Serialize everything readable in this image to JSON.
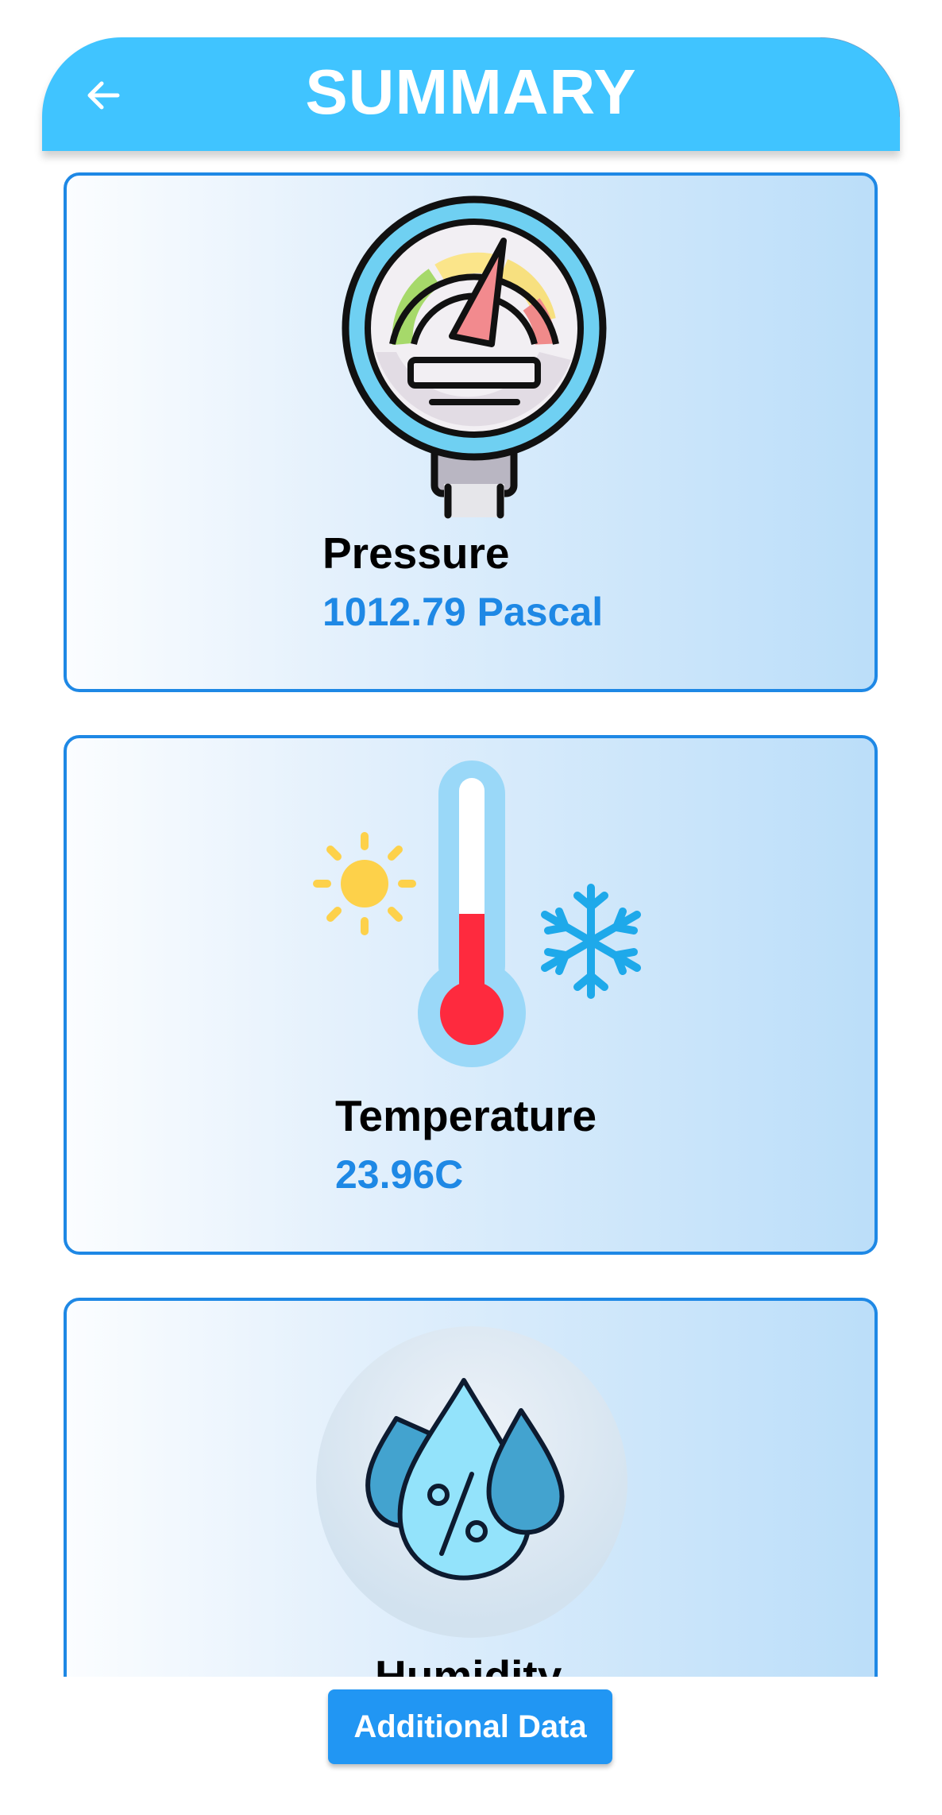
{
  "header": {
    "title": "SUMMARY",
    "back_icon": "arrow-left-icon",
    "color": "#40c4ff"
  },
  "cards": [
    {
      "label": "Pressure",
      "value": "1012.79 Pascal",
      "icon": "pressure-gauge-icon"
    },
    {
      "label": "Temperature",
      "value": "23.96C",
      "icon": "thermometer-icon"
    },
    {
      "label": "Humidity",
      "icon": "humidity-drops-icon"
    }
  ],
  "actions": {
    "additional_data_label": "Additional Data"
  },
  "colors": {
    "accent": "#1e88e5",
    "button": "#2196f3",
    "header": "#40c4ff"
  }
}
